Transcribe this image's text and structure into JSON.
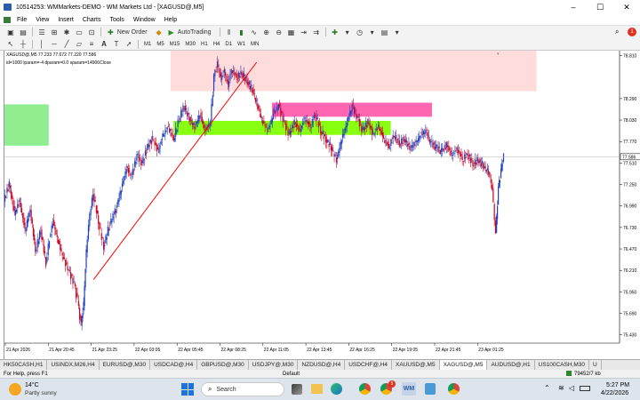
{
  "window": {
    "title": "10514253: WMMarkets-DEMO - WM Markets Ltd - [XAGUSD@,M5]",
    "minimize_glyph": "–",
    "maximize_glyph": "☐",
    "close_glyph": "✕",
    "restore_glyph": "❐"
  },
  "menu": [
    "File",
    "View",
    "Insert",
    "Charts",
    "Tools",
    "Window",
    "Help"
  ],
  "toolbar": {
    "new_order_label": "New Order",
    "autotrading_label": "AutoTrading",
    "timeframes": [
      "M1",
      "M5",
      "M15",
      "M30",
      "H1",
      "H4",
      "D1",
      "W1",
      "MN"
    ],
    "notification_count": "1"
  },
  "chart_info": {
    "symbol_line": "XAGUSD@,M5  77.233 77.672 77.220 77.586",
    "params_line": "id=1000  lparam=-4  dparam=0.0  sparam=14906Close"
  },
  "chart_data": {
    "type": "candlestick",
    "symbol": "XAGUSD@",
    "timeframe": "M5",
    "price_levels": [
      78.81,
      78.29,
      78.03,
      77.77,
      77.51,
      77.25,
      76.99,
      76.73,
      76.47,
      76.21,
      75.95,
      75.69,
      75.43
    ],
    "price_level_labels": [
      "78.810",
      "78.290",
      "78.030",
      "77.770",
      "77.510",
      "77.250",
      "76.990",
      "76.730",
      "76.470",
      "76.210",
      "75.950",
      "75.690",
      "75.430"
    ],
    "ylim": [
      75.33,
      78.87
    ],
    "current_price": 77.586,
    "current_price_label": "77.586",
    "time_labels": [
      "21 Apr 2026",
      "21 Apr 20:45",
      "21 Apr 23:25",
      "22 Apr 03:05",
      "22 Apr 05:45",
      "22 Apr 08:25",
      "22 Apr 11:05",
      "22 Apr 13:45",
      "22 Apr 16:25",
      "22 Apr 19:05",
      "22 Apr 21:45",
      "23 Apr 01:25"
    ],
    "path_points": [
      [
        0,
        77.05
      ],
      [
        6,
        77.25
      ],
      [
        12,
        76.9
      ],
      [
        18,
        77.05
      ],
      [
        24,
        76.7
      ],
      [
        30,
        76.95
      ],
      [
        36,
        76.45
      ],
      [
        42,
        76.7
      ],
      [
        48,
        76.3
      ],
      [
        52,
        76.6
      ],
      [
        56,
        76.8
      ],
      [
        62,
        76.55
      ],
      [
        68,
        76.35
      ],
      [
        74,
        76.2
      ],
      [
        80,
        76.05
      ],
      [
        84,
        75.85
      ],
      [
        88,
        75.55
      ],
      [
        91,
        75.8
      ],
      [
        94,
        76.45
      ],
      [
        98,
        76.9
      ],
      [
        102,
        77.15
      ],
      [
        108,
        76.8
      ],
      [
        114,
        76.5
      ],
      [
        120,
        76.75
      ],
      [
        128,
        76.95
      ],
      [
        134,
        77.2
      ],
      [
        140,
        77.45
      ],
      [
        146,
        77.35
      ],
      [
        152,
        77.6
      ],
      [
        158,
        77.5
      ],
      [
        164,
        77.7
      ],
      [
        170,
        77.8
      ],
      [
        176,
        77.65
      ],
      [
        182,
        77.85
      ],
      [
        188,
        77.95
      ],
      [
        194,
        77.8
      ],
      [
        200,
        78.05
      ],
      [
        206,
        78.2
      ],
      [
        212,
        78.05
      ],
      [
        218,
        77.95
      ],
      [
        224,
        78.1
      ],
      [
        230,
        77.9
      ],
      [
        236,
        78.0
      ],
      [
        240,
        78.55
      ],
      [
        244,
        78.7
      ],
      [
        248,
        78.52
      ],
      [
        252,
        78.62
      ],
      [
        256,
        78.45
      ],
      [
        260,
        78.65
      ],
      [
        266,
        78.55
      ],
      [
        272,
        78.6
      ],
      [
        278,
        78.5
      ],
      [
        284,
        78.4
      ],
      [
        290,
        78.2
      ],
      [
        296,
        78.0
      ],
      [
        302,
        77.9
      ],
      [
        308,
        78.1
      ],
      [
        314,
        78.2
      ],
      [
        320,
        78.0
      ],
      [
        326,
        77.85
      ],
      [
        332,
        78.0
      ],
      [
        338,
        77.9
      ],
      [
        344,
        78.05
      ],
      [
        350,
        77.95
      ],
      [
        356,
        78.1
      ],
      [
        362,
        77.9
      ],
      [
        368,
        77.8
      ],
      [
        374,
        77.7
      ],
      [
        380,
        77.55
      ],
      [
        386,
        77.8
      ],
      [
        392,
        78.0
      ],
      [
        398,
        78.2
      ],
      [
        404,
        78.05
      ],
      [
        410,
        77.9
      ],
      [
        416,
        78.0
      ],
      [
        422,
        77.85
      ],
      [
        428,
        77.95
      ],
      [
        434,
        77.8
      ],
      [
        440,
        77.7
      ],
      [
        446,
        77.85
      ],
      [
        452,
        77.75
      ],
      [
        458,
        77.8
      ],
      [
        464,
        77.7
      ],
      [
        470,
        77.75
      ],
      [
        476,
        77.85
      ],
      [
        482,
        77.9
      ],
      [
        488,
        77.75
      ],
      [
        494,
        77.7
      ],
      [
        500,
        77.65
      ],
      [
        506,
        77.72
      ],
      [
        512,
        77.6
      ],
      [
        518,
        77.68
      ],
      [
        524,
        77.55
      ],
      [
        530,
        77.62
      ],
      [
        536,
        77.5
      ],
      [
        542,
        77.55
      ],
      [
        548,
        77.48
      ],
      [
        554,
        77.4
      ],
      [
        558,
        77.2
      ],
      [
        562,
        76.65
      ],
      [
        565,
        77.2
      ],
      [
        568,
        77.4
      ],
      [
        571,
        77.586
      ]
    ],
    "zones": [
      {
        "color": "#ffdcdc",
        "x_start": 0.27,
        "x_end": 0.865,
        "y_top": 78.87,
        "y_bottom": 78.38
      },
      {
        "color": "#90ee90",
        "x_start": 0.0,
        "x_end": 0.072,
        "y_top": 78.22,
        "y_bottom": 77.72
      },
      {
        "color": "#ff66b2",
        "x_start": 0.435,
        "x_end": 0.695,
        "y_top": 78.24,
        "y_bottom": 78.07
      },
      {
        "color": "#88ff11",
        "x_start": 0.275,
        "x_end": 0.628,
        "y_top": 78.02,
        "y_bottom": 77.85
      }
    ],
    "trendline": {
      "color": "#ff0000",
      "from": [
        0.145,
        76.1
      ],
      "to": [
        0.41,
        78.73
      ]
    },
    "grid": false,
    "colors": {
      "bull": "#1f3fbf",
      "bear": "#cc0022",
      "bg": "#ffffff",
      "axis": "#000000"
    }
  },
  "tabs": [
    {
      "label": "HK50CASH,H1"
    },
    {
      "label": "USINDX,M26,H4"
    },
    {
      "label": "EURUSD@,M30"
    },
    {
      "label": "USDCAD@,H4"
    },
    {
      "label": "GBPUSD@,M30"
    },
    {
      "label": "USDJPY@,M30"
    },
    {
      "label": "NZDUSD@,H4"
    },
    {
      "label": "USDCHF@,H4"
    },
    {
      "label": "XAUUSD@,M5"
    },
    {
      "label": "XAGUSD@,M5",
      "active": true
    },
    {
      "label": "AUDUSD@,H1"
    },
    {
      "label": "US100CASH,M30"
    },
    {
      "label": "U"
    }
  ],
  "status": {
    "help": "For Help, press F1",
    "profile": "Default",
    "traffic": "79452/7 kb"
  },
  "taskbar": {
    "weather_temp": "14°C",
    "weather_desc": "Partly sunny",
    "search_placeholder": "Search",
    "time": "5:27 PM",
    "date": "4/22/2026",
    "badge_count": "5"
  }
}
